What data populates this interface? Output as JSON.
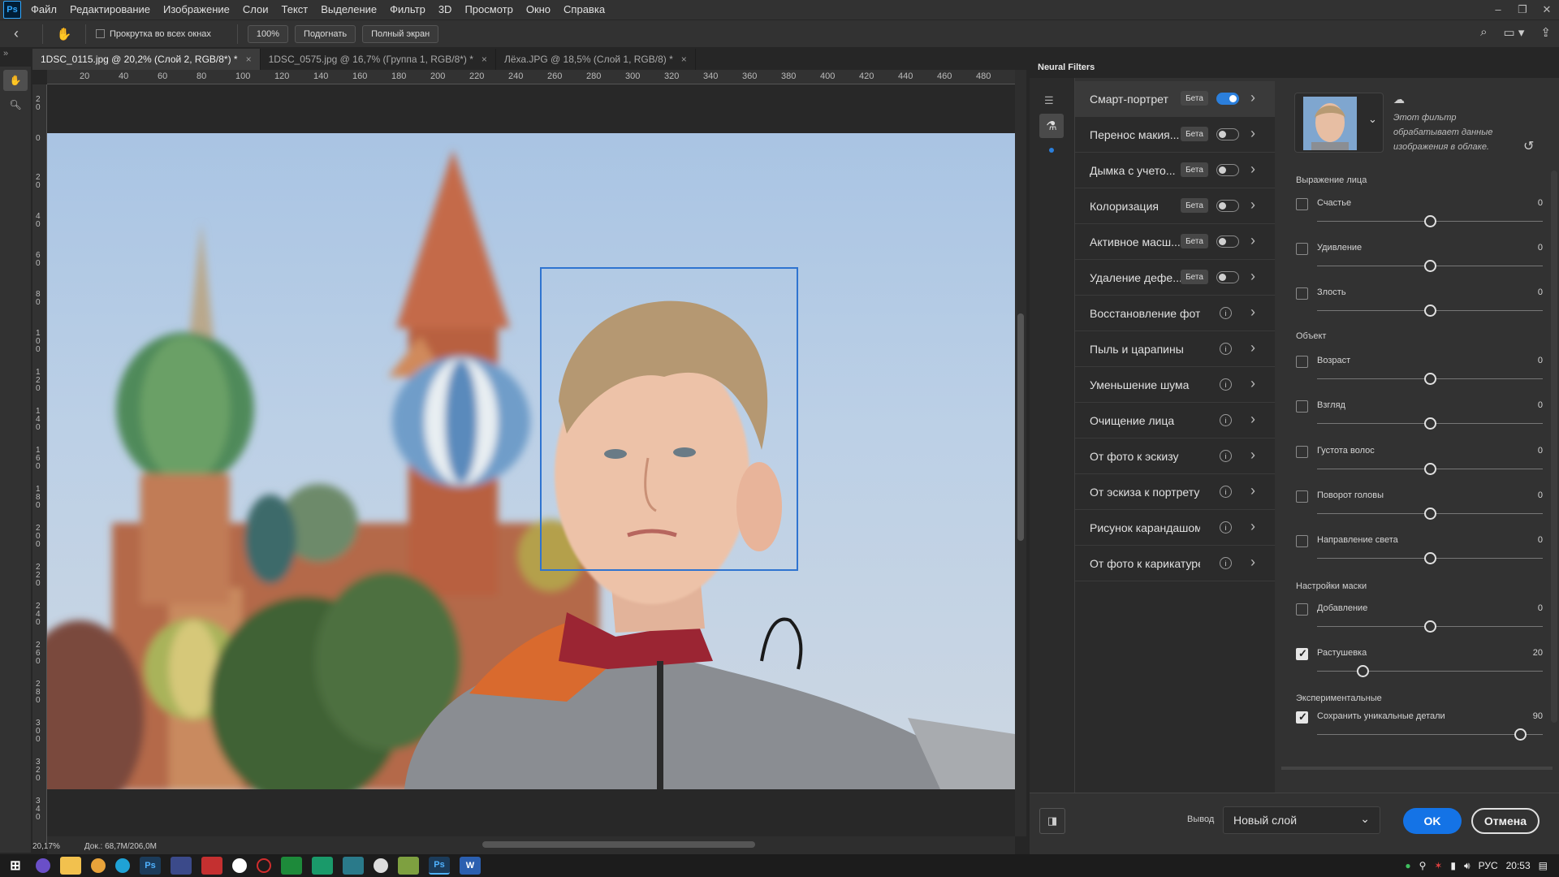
{
  "app": {
    "logo": "Ps"
  },
  "menu": [
    "Файл",
    "Редактирование",
    "Изображение",
    "Слои",
    "Текст",
    "Выделение",
    "Фильтр",
    "3D",
    "Просмотр",
    "Окно",
    "Справка"
  ],
  "options_bar": {
    "scroll_all_label": "Прокрутка во всех окнах",
    "zoom_value": "100%",
    "fit_label": "Подогнать",
    "fullscreen_label": "Полный экран"
  },
  "tabs": [
    {
      "label": "1DSC_0115.jpg @ 20,2% (Слой 2, RGB/8*) *",
      "active": true
    },
    {
      "label": "1DSC_0575.jpg @ 16,7% (Группа 1, RGB/8*) *",
      "active": false
    },
    {
      "label": "Лёха.JPG @ 18,5% (Слой 1, RGB/8) *",
      "active": false
    }
  ],
  "ruler_top": [
    "20",
    "40",
    "60",
    "80",
    "100",
    "120",
    "140",
    "160",
    "180",
    "200",
    "220",
    "240",
    "260",
    "280",
    "300",
    "320",
    "340",
    "360",
    "380",
    "400",
    "420",
    "440",
    "460",
    "480"
  ],
  "ruler_left": [
    "2 0",
    "0",
    "2 0",
    "4 0",
    "6 0",
    "8 0",
    "1 0 0",
    "1 2 0",
    "1 4 0",
    "1 6 0",
    "1 8 0",
    "2 0 0",
    "2 2 0",
    "2 4 0",
    "2 6 0",
    "2 8 0",
    "3 0 0",
    "3 2 0",
    "3 4 0"
  ],
  "status": {
    "zoom": "20,17%",
    "doc": "Док.: 68,7M/206,0M"
  },
  "neural_filters": {
    "title": "Neural Filters",
    "beta_label": "Бета",
    "filters": [
      {
        "name": "Смарт-портрет",
        "type": "beta",
        "on": true
      },
      {
        "name": "Перенос макия...",
        "type": "beta",
        "on": false
      },
      {
        "name": "Дымка с учето...",
        "type": "beta",
        "on": false
      },
      {
        "name": "Колоризация",
        "type": "beta",
        "on": false
      },
      {
        "name": "Активное масш...",
        "type": "beta",
        "on": false
      },
      {
        "name": "Удаление дефе...",
        "type": "beta",
        "on": false
      },
      {
        "name": "Восстановление фот...",
        "type": "info"
      },
      {
        "name": "Пыль и царапины",
        "type": "info"
      },
      {
        "name": "Уменьшение шума",
        "type": "info"
      },
      {
        "name": "Очищение лица",
        "type": "info"
      },
      {
        "name": "От фото к эскизу",
        "type": "info"
      },
      {
        "name": "От эскиза к портрету",
        "type": "info"
      },
      {
        "name": "Рисунок карандашом",
        "type": "info"
      },
      {
        "name": "От фото к карикатуре",
        "type": "info"
      }
    ],
    "cloud_note": "Этот фильтр обрабатывает данные изображения в облаке.",
    "sections": {
      "face": "Выражение лица",
      "object": "Объект",
      "mask": "Настройки маски",
      "experimental": "Экспериментальные"
    },
    "sliders": [
      {
        "label": "Счастье",
        "value": "0",
        "checked": false,
        "pos": 0.5
      },
      {
        "label": "Удивление",
        "value": "0",
        "checked": false,
        "pos": 0.5
      },
      {
        "label": "Злость",
        "value": "0",
        "checked": false,
        "pos": 0.5
      },
      {
        "label": "Возраст",
        "value": "0",
        "checked": false,
        "pos": 0.5
      },
      {
        "label": "Взгляд",
        "value": "0",
        "checked": false,
        "pos": 0.5
      },
      {
        "label": "Густота волос",
        "value": "0",
        "checked": false,
        "pos": 0.5
      },
      {
        "label": "Поворот головы",
        "value": "0",
        "checked": false,
        "pos": 0.5
      },
      {
        "label": "Направление света",
        "value": "0",
        "checked": false,
        "pos": 0.5
      },
      {
        "label": "Добавление",
        "value": "0",
        "checked": false,
        "pos": 0.5
      },
      {
        "label": "Растушевка",
        "value": "20",
        "checked": true,
        "pos": 0.2
      },
      {
        "label": "Сохранить уникальные детали",
        "value": "90",
        "checked": true,
        "pos": 0.9
      }
    ],
    "output_label": "Вывод",
    "output_value": "Новый слой",
    "ok_label": "OK",
    "cancel_label": "Отмена"
  },
  "taskbar": {
    "lang": "РУС",
    "time": "20:53"
  }
}
